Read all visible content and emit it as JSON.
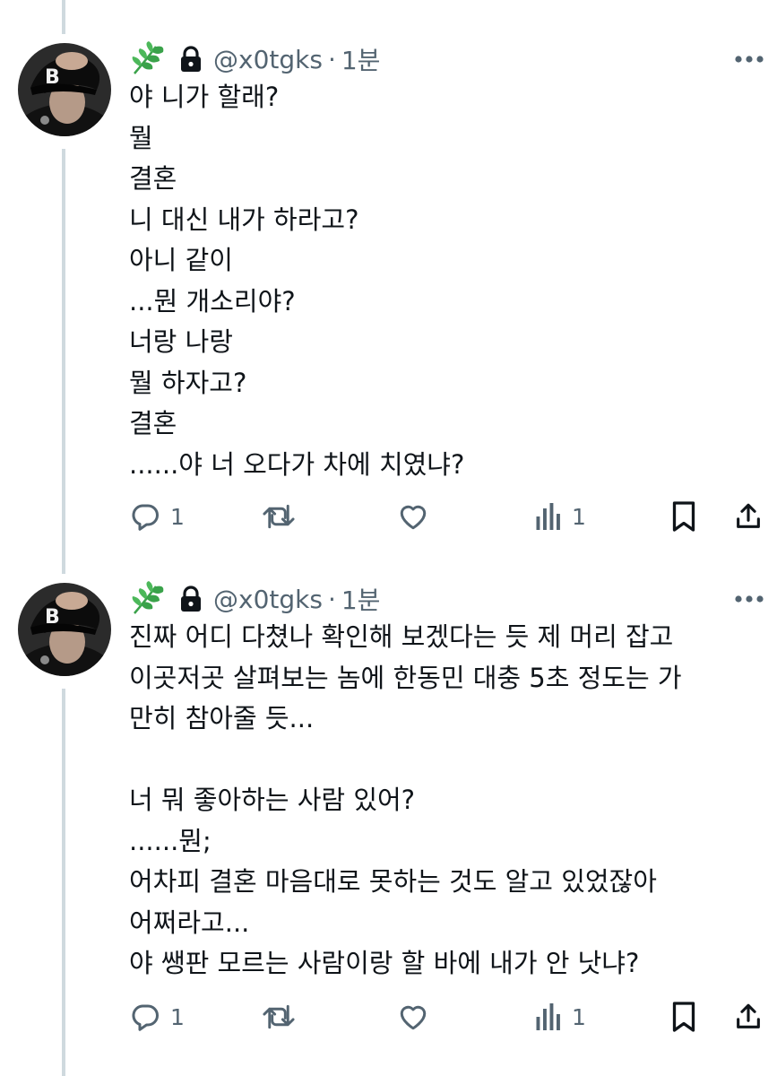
{
  "tweets": [
    {
      "author": {
        "handle": "@x0tgks",
        "time": "1분",
        "dot": "·",
        "leaf_icon": "herb-leaf-icon",
        "lock_icon": "lock-icon"
      },
      "text": "야 니가 할래?\n뭘\n결혼\n니 대신 내가 하라고?\n아니 같이\n...뭔 개소리야?\n너랑 나랑\n뭘 하자고?\n결혼\n......야 너 오다가 차에 치였냐?",
      "actions": {
        "reply_count": "1",
        "retweet_count": "",
        "like_count": "",
        "views_count": "1"
      }
    },
    {
      "author": {
        "handle": "@x0tgks",
        "time": "1분",
        "dot": "·",
        "leaf_icon": "herb-leaf-icon",
        "lock_icon": "lock-icon"
      },
      "text": "진짜 어디 다쳤나 확인해 보겠다는 듯 제 머리 잡고\n이곳저곳 살펴보는 놈에 한동민 대충 5초 정도는 가\n만히 참아줄 듯...\n\n너 뭐 좋아하는 사람 있어?\n......뭔;\n어차피 결혼 마음대로 못하는 것도 알고 있었잖아\n어쩌라고...\n야 쌩판 모르는 사람이랑 할 바에 내가 안 낫냐?",
      "actions": {
        "reply_count": "1",
        "retweet_count": "",
        "like_count": "",
        "views_count": "1"
      }
    }
  ],
  "colors": {
    "text": "#0f1419",
    "secondary": "#536471",
    "thread_line": "#cfd9de",
    "leaf": "#3aa24a"
  }
}
